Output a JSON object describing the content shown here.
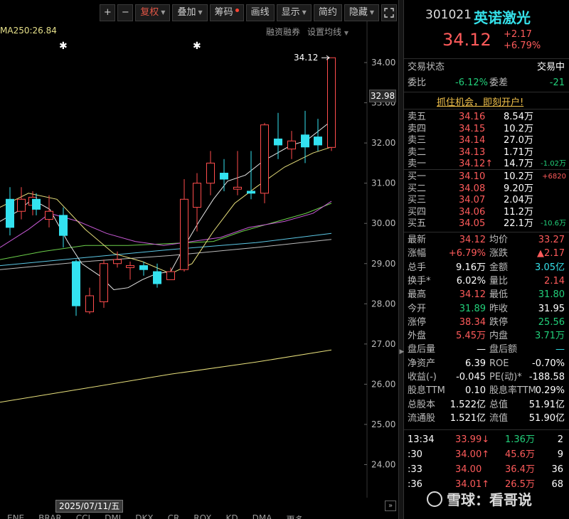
{
  "toolbar": {
    "plus": "+",
    "minus": "−",
    "fuquan": "复权",
    "diejia": "叠加",
    "chouma": "筹码",
    "huaxian": "画线",
    "xianshi": "显示",
    "jianyue": "简约",
    "yincang": "隐藏",
    "fullscreen_icon": "expand-icon"
  },
  "chart": {
    "ma_label": "MA250:26.84",
    "rongzi": "融资融券",
    "set_ma": "设置均线",
    "high_label": "34.12",
    "current_price": "32.98",
    "y_ticks": [
      "34.00",
      "33.00",
      "32.00",
      "31.00",
      "30.00",
      "29.00",
      "28.00",
      "27.00",
      "26.00",
      "25.00",
      "24.00"
    ],
    "date_label": "2025/07/11/五",
    "expand": "»",
    "indicator_tabs": [
      "ENE",
      "BRAR",
      "CCI",
      "DMI",
      "DKX",
      "CR",
      "ROX",
      "KD",
      "DMA",
      "更多"
    ],
    "colors": {
      "up": "#ff4d4d",
      "down": "#33e2f0",
      "ma5": "#e6e6e6",
      "ma10": "#e8e07c",
      "ma20": "#c85ad6",
      "ma30": "#6ccf4a",
      "ma60": "#5cc8e6",
      "ma120": "#bbbbbb",
      "ma250": "#e8e07c"
    }
  },
  "quote": {
    "code": "301021",
    "name": "英诺激光",
    "price": "34.12",
    "change": "+2.17",
    "change_pct": "+6.79%",
    "status_label": "交易状态",
    "status_value": "交易中",
    "weibi_label": "委比",
    "weibi_value": "-6.12%",
    "weicha_label": "委差",
    "weicha_value": "-21",
    "promo": "抓住机会，即刻开户!",
    "asks": [
      {
        "label": "卖五",
        "price": "34.16",
        "vol": "8.54万",
        "extra": ""
      },
      {
        "label": "卖四",
        "price": "34.15",
        "vol": "10.2万",
        "extra": ""
      },
      {
        "label": "卖三",
        "price": "34.14",
        "vol": "27.0万",
        "extra": ""
      },
      {
        "label": "卖二",
        "price": "34.13",
        "vol": "1.71万",
        "extra": ""
      },
      {
        "label": "卖一",
        "price": "34.12↑",
        "vol": "14.7万",
        "extra": "-1.02万"
      }
    ],
    "bids": [
      {
        "label": "买一",
        "price": "34.10",
        "vol": "10.2万",
        "extra": "+6820"
      },
      {
        "label": "买二",
        "price": "34.08",
        "vol": "9.20万",
        "extra": ""
      },
      {
        "label": "买三",
        "price": "34.07",
        "vol": "2.04万",
        "extra": ""
      },
      {
        "label": "买四",
        "price": "34.06",
        "vol": "11.2万",
        "extra": ""
      },
      {
        "label": "买五",
        "price": "34.05",
        "vol": "22.1万",
        "extra": "-10.6万"
      }
    ],
    "stats": [
      {
        "l1": "最新",
        "v1": "34.12",
        "c1": "red",
        "l2": "均价",
        "v2": "33.27",
        "c2": "red"
      },
      {
        "l1": "涨幅",
        "v1": "+6.79%",
        "c1": "red",
        "l2": "涨跌",
        "v2": "▲2.17",
        "c2": "red"
      },
      {
        "l1": "总手",
        "v1": "9.16万",
        "c1": "white",
        "l2": "金额",
        "v2": "3.05亿",
        "c2": "cyan"
      },
      {
        "l1": "换手*",
        "v1": "6.02%",
        "c1": "white",
        "l2": "量比",
        "v2": "2.14",
        "c2": "red"
      },
      {
        "l1": "最高",
        "v1": "34.12",
        "c1": "red",
        "l2": "最低",
        "v2": "31.80",
        "c2": "green"
      },
      {
        "l1": "今开",
        "v1": "31.89",
        "c1": "green",
        "l2": "昨收",
        "v2": "31.95",
        "c2": "white"
      },
      {
        "l1": "涨停",
        "v1": "38.34",
        "c1": "red",
        "l2": "跌停",
        "v2": "25.56",
        "c2": "green"
      },
      {
        "l1": "外盘",
        "v1": "5.45万",
        "c1": "red",
        "l2": "内盘",
        "v2": "3.71万",
        "c2": "green"
      },
      {
        "l1": "盘后量",
        "v1": "—",
        "c1": "white",
        "l2": "盘后额",
        "v2": "—",
        "c2": "cyan"
      },
      {
        "l1": "净资产",
        "v1": "6.39",
        "c1": "white",
        "l2": "ROE",
        "v2": "-0.70%",
        "c2": "white"
      },
      {
        "l1": "收益(-)",
        "v1": "-0.045",
        "c1": "white",
        "l2": "PE(动)*",
        "v2": "-188.58",
        "c2": "white"
      },
      {
        "l1": "股息TTM",
        "v1": "0.10",
        "c1": "white",
        "l2": "股息率TTM",
        "v2": "0.29%",
        "c2": "white"
      },
      {
        "l1": "总股本",
        "v1": "1.522亿",
        "c1": "white",
        "l2": "总值",
        "v2": "51.91亿",
        "c2": "white"
      },
      {
        "l1": "流通股",
        "v1": "1.521亿",
        "c1": "white",
        "l2": "流值",
        "v2": "51.90亿",
        "c2": "white"
      }
    ],
    "ticks": [
      {
        "time": "13:34",
        "price": "33.99↓",
        "pcolor": "red",
        "vol": "1.36万",
        "vcolor": "green",
        "n": "2"
      },
      {
        "time": ":30",
        "price": "34.00↑",
        "pcolor": "red",
        "vol": "45.6万",
        "vcolor": "red",
        "n": "9"
      },
      {
        "time": ":33",
        "price": "34.00",
        "pcolor": "red",
        "vol": "36.4万",
        "vcolor": "red",
        "n": "36"
      },
      {
        "time": ":36",
        "price": "34.01↑",
        "pcolor": "red",
        "vol": "26.5万",
        "vcolor": "red",
        "n": "68"
      }
    ],
    "watermark": "雪球：看哥说"
  }
}
